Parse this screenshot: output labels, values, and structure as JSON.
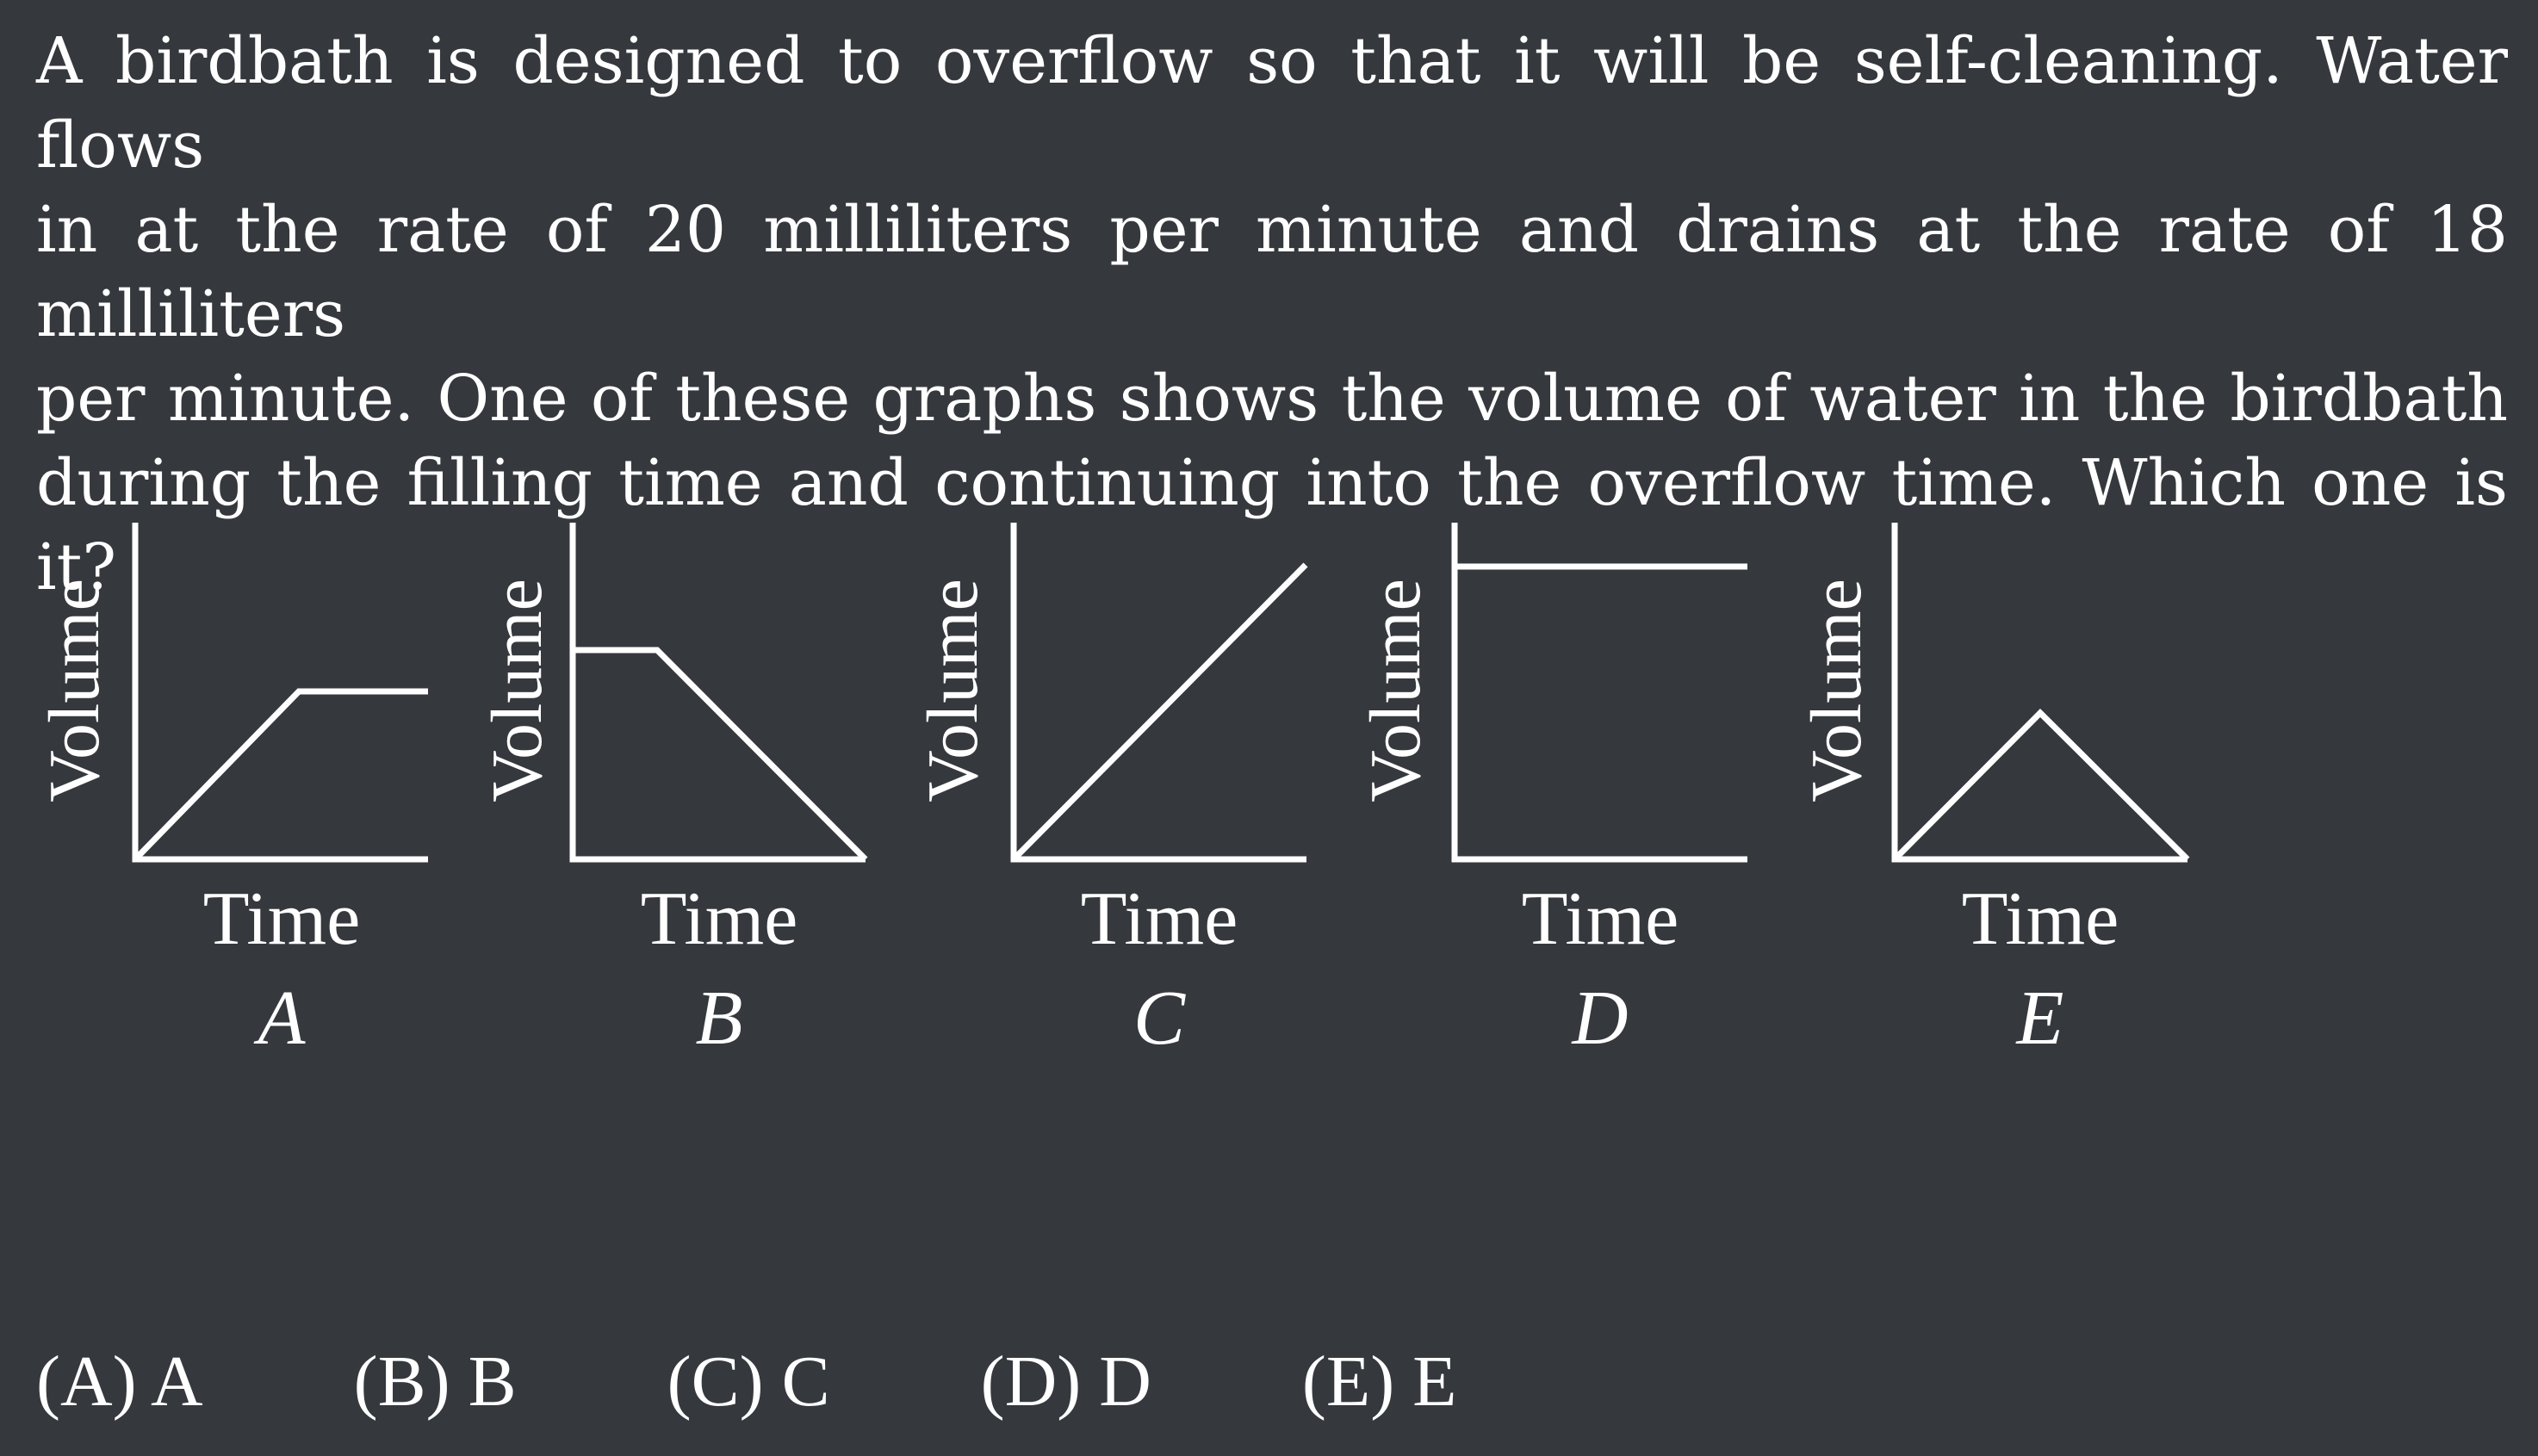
{
  "question": {
    "lines": [
      "A birdbath is designed to overflow so that it will be self-cleaning.  Water flows",
      "in at the rate of 20 milliliters per minute and drains at the rate of 18 milliliters",
      "per minute.  One of these graphs shows the volume of water in the birdbath",
      "during the filling time and continuing into the overflow time.  Which one is it?"
    ]
  },
  "graphs": [
    {
      "letter": "A",
      "x_label": "Time",
      "y_label": "Volume",
      "shape": "rise-then-level"
    },
    {
      "letter": "B",
      "x_label": "Time",
      "y_label": "Volume",
      "shape": "level-then-fall"
    },
    {
      "letter": "C",
      "x_label": "Time",
      "y_label": "Volume",
      "shape": "steady-rise"
    },
    {
      "letter": "D",
      "x_label": "Time",
      "y_label": "Volume",
      "shape": "constant-high"
    },
    {
      "letter": "E",
      "x_label": "Time",
      "y_label": "Volume",
      "shape": "rise-then-fall"
    }
  ],
  "choices": [
    "(A) A",
    "(B) B",
    "(C) C",
    "(D) D",
    "(E) E"
  ]
}
